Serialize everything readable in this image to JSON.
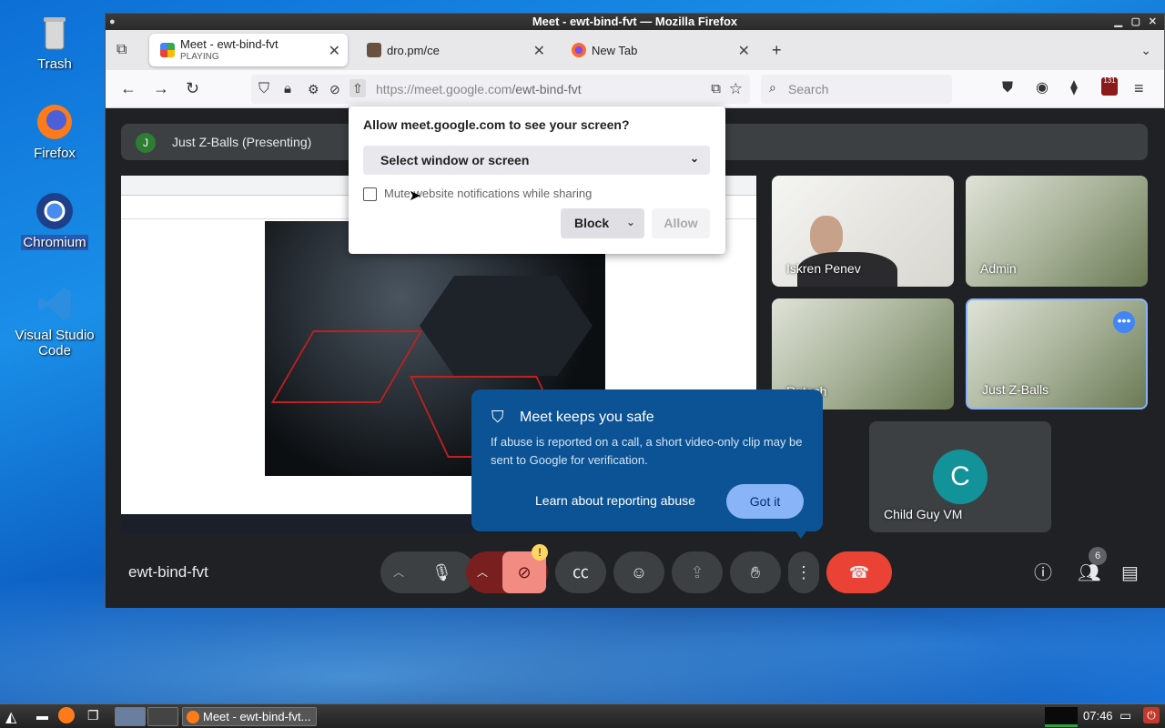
{
  "desktop": {
    "icons": [
      {
        "label": "Trash"
      },
      {
        "label": "Firefox"
      },
      {
        "label": "Chromium"
      },
      {
        "label": "Visual Studio Code"
      }
    ]
  },
  "window": {
    "title": "Meet - ewt-bind-fvt — Mozilla Firefox"
  },
  "tabs": [
    {
      "label": "Meet - ewt-bind-fvt",
      "sublabel": "PLAYING"
    },
    {
      "label": "dro.pm/ce"
    },
    {
      "label": "New Tab"
    }
  ],
  "navbar": {
    "url_host": "https://meet.google.com",
    "url_path": "/ewt-bind-fvt",
    "search_placeholder": "Search",
    "badge": "131"
  },
  "permission": {
    "question": "Allow meet.google.com to see your screen?",
    "select_label": "Select window or screen",
    "mute_label": "Mute website notifications while sharing",
    "block_label": "Block",
    "allow_label": "Allow"
  },
  "meet": {
    "presenter_initial": "J",
    "presenter_label": "Just Z-Balls (Presenting)",
    "meeting_code": "ewt-bind-fvt",
    "participants_count": "6",
    "tiles": [
      {
        "name": "Iskren Penev"
      },
      {
        "name": "Admin"
      },
      {
        "name": "Rutesh"
      },
      {
        "name": "Just Z-Balls"
      },
      {
        "name": "Child Guy VM",
        "initial": "C"
      }
    ],
    "safe_popup": {
      "heading": "Meet keeps you safe",
      "body": "If abuse is reported on a call, a short video-only clip may be sent to Google for verification.",
      "learn": "Learn about reporting abuse",
      "got_it": "Got it"
    }
  },
  "taskbar": {
    "task_label": "Meet - ewt-bind-fvt...",
    "clock": "07:46"
  },
  "colors": {
    "accent": "#8ab4f8",
    "hangup": "#ea4335",
    "popup_bg": "#0b5394"
  }
}
